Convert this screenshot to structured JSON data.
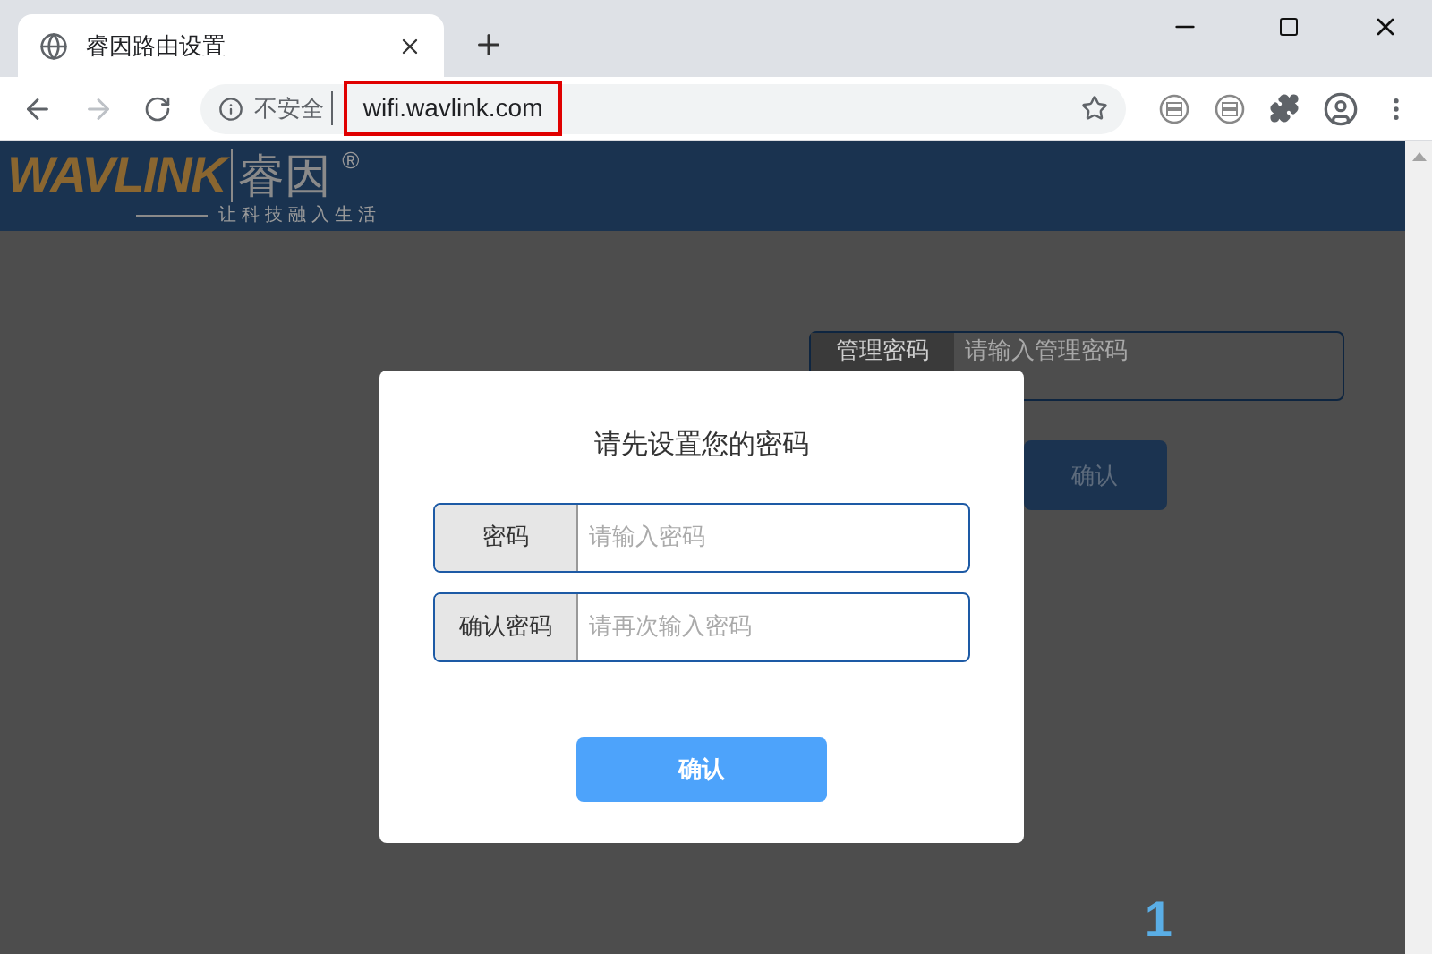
{
  "browser": {
    "tab": {
      "title": "睿因路由设置"
    },
    "address": {
      "security": "不安全",
      "url": "wifi.wavlink.com",
      "highlighted": true
    }
  },
  "header": {
    "logo": "WAVLINK",
    "logo_cn": "睿因",
    "registered": "®",
    "slogan": "让科技融入生活"
  },
  "login": {
    "label": "管理密码",
    "placeholder": "请输入管理密码",
    "button": "确认"
  },
  "corner_text": "1",
  "dialog": {
    "title": "请先设置您的密码",
    "fields": [
      {
        "label": "密码",
        "placeholder": "请输入密码"
      },
      {
        "label": "确认密码",
        "placeholder": "请再次输入密码"
      }
    ],
    "button": "确认"
  }
}
